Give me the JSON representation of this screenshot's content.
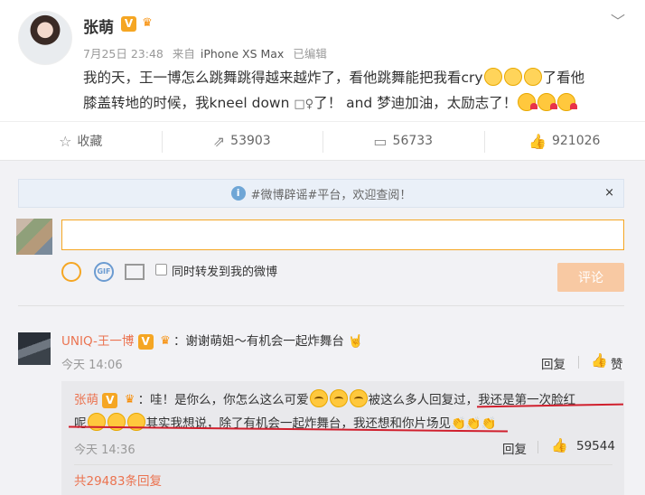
{
  "post": {
    "author": "张萌",
    "timestamp": "7月25日 23:48",
    "source_prefix": "来自",
    "source": "iPhone XS Max",
    "edited": "已编辑",
    "content_line1": "我的天，王一博怎么跳舞跳得越来越炸了，看他跳舞能把我看cry",
    "content_line1_tail": "了看他",
    "content_line2": "膝盖转地的时候，我kneel down",
    "content_line2_tail": "了！ and 梦迪加油，太励志了！"
  },
  "actions": {
    "favorite": "收藏",
    "repost": "53903",
    "comment": "56733",
    "like": "921026"
  },
  "notice": {
    "text": "#微博辟谣#平台，欢迎查阅！",
    "close": "×"
  },
  "composer": {
    "repost_option": "同时转发到我的微博",
    "submit": "评论"
  },
  "comment": {
    "user": "UNIQ-王一博",
    "text": "：谢谢萌姐～有机会一起炸舞台",
    "time": "今天 14:06",
    "reply": "回复",
    "like": "赞",
    "reply_item": {
      "user": "张萌",
      "text_a": "：哇！是你么，你怎么这么可爱",
      "text_b": "被这么多人回复过，我还是第一次脸红",
      "text_c": "呢",
      "text_d": "其实我想说，除了有机会一起炸舞台，我还想和你片场见",
      "time": "今天 14:36",
      "reply": "回复",
      "likes": "59544"
    },
    "more_replies": "共29483条回复"
  },
  "colors": {
    "accent": "#eb7350",
    "orange": "#f5a623",
    "underline": "#d01f2d"
  }
}
